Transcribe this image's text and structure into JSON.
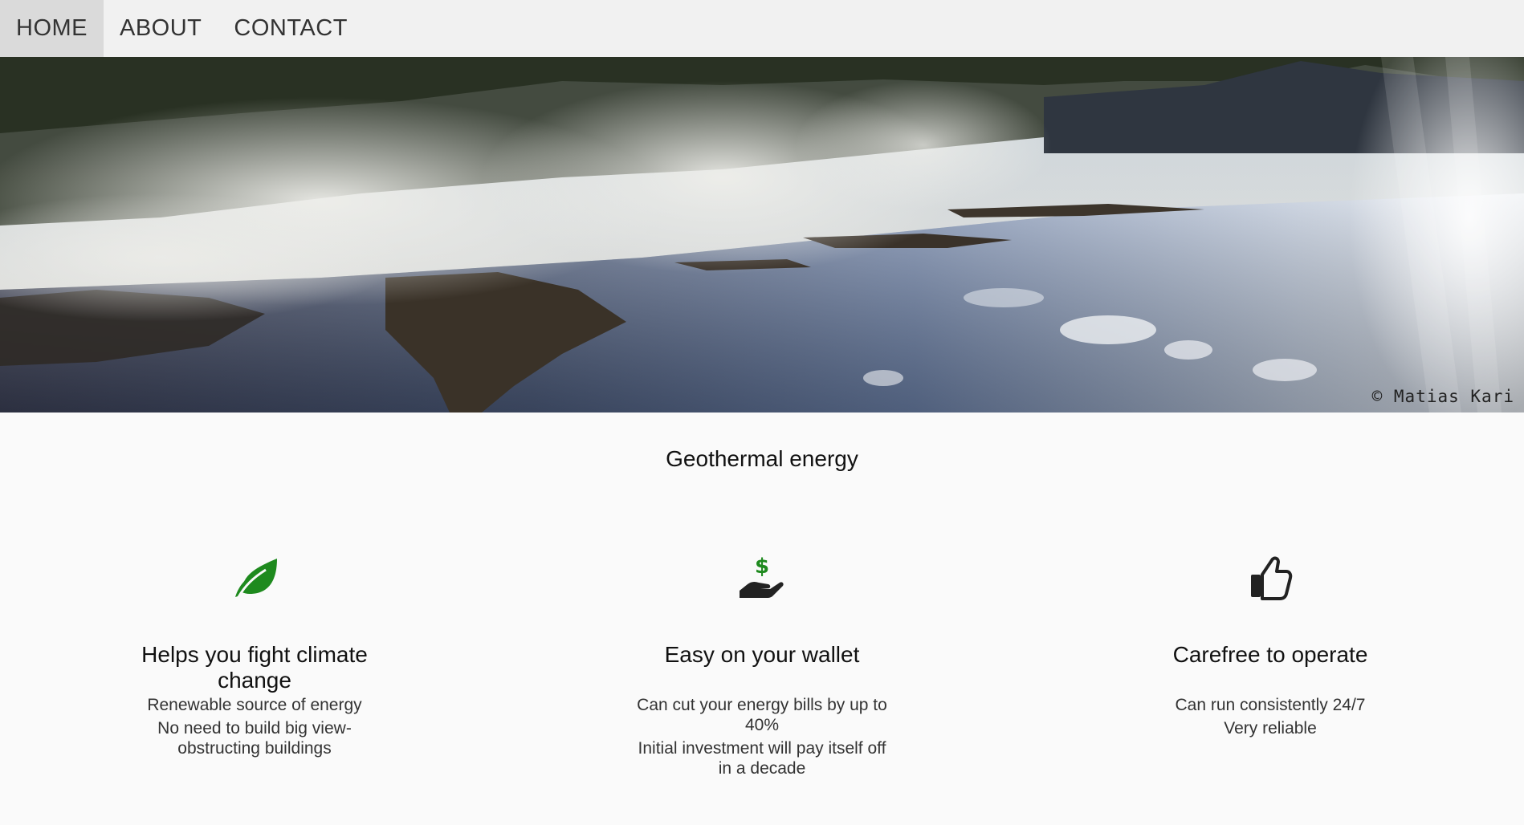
{
  "nav": {
    "items": [
      {
        "label": "HOME",
        "active": true
      },
      {
        "label": "ABOUT",
        "active": false
      },
      {
        "label": "CONTACT",
        "active": false
      }
    ]
  },
  "hero": {
    "credit": "© Matias Kari"
  },
  "main": {
    "title": "Geothermal energy",
    "features": [
      {
        "icon": "leaf-icon",
        "icon_color": "#1e8a1e",
        "heading": "Helps you fight climate change",
        "lines": [
          "Renewable source of energy",
          "No need to build big view-obstructing buildings"
        ]
      },
      {
        "icon": "hand-dollar-icon",
        "icon_color": "#1e8a1e",
        "heading": "Easy on your wallet",
        "lines": [
          "Can cut your energy bills by up to 40%",
          "Initial investment will pay itself off in a decade"
        ]
      },
      {
        "icon": "thumbs-up-icon",
        "icon_color": "#222222",
        "heading": "Carefree to operate",
        "lines": [
          "Can run consistently 24/7",
          "Very reliable"
        ]
      }
    ]
  },
  "colors": {
    "nav_bg": "#f1f1f1",
    "nav_active_bg": "#dadada",
    "page_bg": "#fafafa",
    "accent_green": "#1e8a1e"
  }
}
